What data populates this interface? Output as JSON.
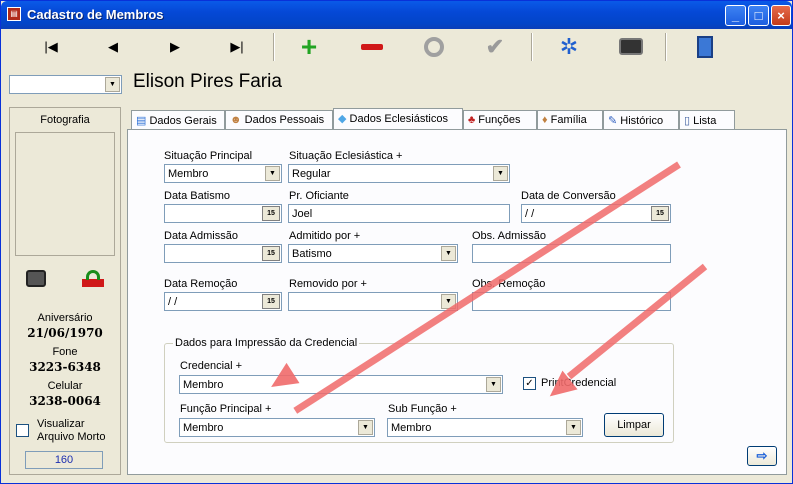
{
  "window": {
    "title": "Cadastro de Membros"
  },
  "member_name": "Elison Pires Faria",
  "left": {
    "photo_label": "Fotografia",
    "birthday_label": "Aniversário",
    "birthday": "21/06/1970",
    "phone_label": "Fone",
    "phone": "3223-6348",
    "cell_label": "Celular",
    "cell": "3238-0064",
    "archive_label_1": "Visualizar",
    "archive_label_2": "Arquivo Morto",
    "count": "160"
  },
  "tabs": [
    {
      "label": "Dados Gerais"
    },
    {
      "label": "Dados Pessoais"
    },
    {
      "label": "Dados Eclesiásticos"
    },
    {
      "label": "Funções"
    },
    {
      "label": "Família"
    },
    {
      "label": "Histórico"
    },
    {
      "label": "Lista"
    }
  ],
  "form": {
    "situacao_principal_label": "Situação Principal",
    "situacao_principal": "Membro",
    "situacao_eclesiastica_label": "Situação Eclesiástica +",
    "situacao_eclesiastica": "Regular",
    "data_batismo_label": "Data Batismo",
    "data_batismo": "",
    "pr_oficiante_label": "Pr. Oficiante",
    "pr_oficiante": "Joel",
    "data_conversao_label": "Data de Conversão",
    "data_conversao": " / /",
    "data_admissao_label": "Data Admissão",
    "data_admissao": "",
    "admitido_por_label": "Admitido por +",
    "admitido_por": "Batismo",
    "obs_admissao_label": "Obs. Admissão",
    "obs_admissao": "",
    "data_remocao_label": "Data Remoção",
    "data_remocao": " / /",
    "removido_por_label": "Removido por +",
    "removido_por": "",
    "obs_remocao_label": "Obs. Remoção",
    "obs_remocao": "",
    "date_button": "15"
  },
  "credencial": {
    "group_title": "Dados para Impressão da Credencial",
    "credencial_label": "Credencial +",
    "credencial": "Membro",
    "print_label": "PrintCredencial",
    "funcao_label": "Função Principal +",
    "funcao": "Membro",
    "sub_funcao_label": "Sub Função +",
    "sub_funcao": "Membro",
    "limpar_label": "Limpar"
  },
  "colors": {
    "accent": "#0a5ae8",
    "annotation_arrow": "#f06a6a"
  }
}
